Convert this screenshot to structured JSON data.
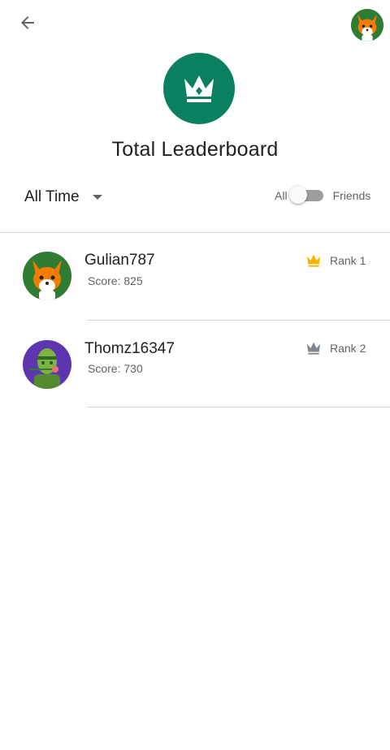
{
  "header": {
    "back_icon": "arrow-left-icon",
    "profile_avatar_icon": "fox-avatar"
  },
  "hero": {
    "icon": "crown-icon",
    "color": "#0b8060",
    "title": "Total Leaderboard"
  },
  "filter": {
    "time_range": "All Time",
    "toggle_left_label": "All",
    "toggle_right_label": "Friends",
    "toggle_state": "All"
  },
  "leaderboard": {
    "rows": [
      {
        "name": "Gulian787",
        "score": "Score: 825",
        "rank": "Rank 1",
        "crown_color": "#f4b400",
        "avatar": "fox-avatar"
      },
      {
        "name": "Thomz16347",
        "score": "Score: 730",
        "rank": "Rank 2",
        "crown_color": "#80868b",
        "avatar": "zombie-avatar"
      }
    ]
  }
}
